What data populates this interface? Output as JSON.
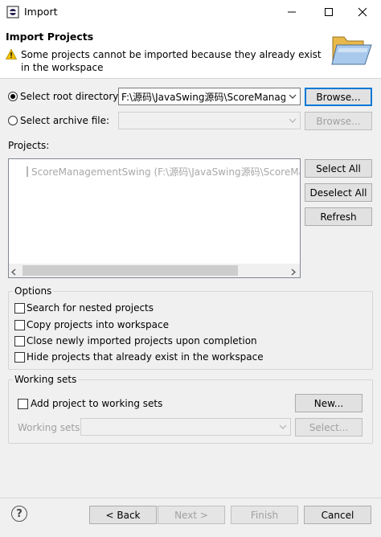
{
  "window": {
    "title": "Import"
  },
  "header": {
    "title": "Import Projects",
    "message": "Some projects cannot be imported because they already exist in the workspace"
  },
  "source": {
    "root_label": "Select root directory:",
    "root_value": "F:\\源码\\JavaSwing源码\\ScoreManagem",
    "root_browse": "Browse...",
    "archive_label": "Select archive file:",
    "archive_browse": "Browse..."
  },
  "projects": {
    "label": "Projects:",
    "items": [
      {
        "text": "ScoreManagementSwing (F:\\源码\\JavaSwing源码\\ScoreManage"
      }
    ],
    "select_all": "Select All",
    "deselect_all": "Deselect All",
    "refresh": "Refresh"
  },
  "options": {
    "title": "Options",
    "items": [
      {
        "label": "Search for nested projects"
      },
      {
        "label": "Copy projects into workspace"
      },
      {
        "label": "Close newly imported projects upon completion"
      },
      {
        "label": "Hide projects that already exist in the workspace"
      }
    ]
  },
  "working_sets": {
    "title": "Working sets",
    "add_label": "Add project to working sets",
    "new_button": "New...",
    "sets_label": "Working sets:",
    "select_button": "Select..."
  },
  "footer": {
    "help": "?",
    "back": "< Back",
    "next": "Next >",
    "finish": "Finish",
    "cancel": "Cancel"
  },
  "icons": {
    "app": "eclipse-icon",
    "warning": "warning-icon",
    "banner": "folder-icon"
  },
  "colors": {
    "accent": "#0078d7",
    "warning": "#f2c200"
  }
}
